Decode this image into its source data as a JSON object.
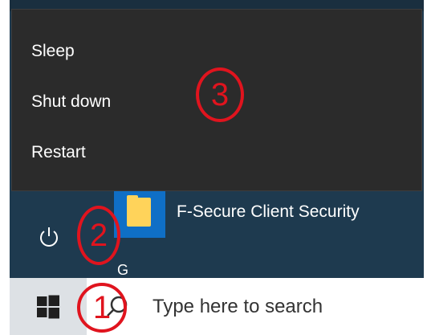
{
  "power_menu": {
    "items": [
      {
        "label": "Sleep"
      },
      {
        "label": "Shut down"
      },
      {
        "label": "Restart"
      }
    ]
  },
  "start_menu": {
    "power_icon": "power-icon",
    "app": {
      "label": "F-Secure Client Security",
      "icon": "folder-icon"
    },
    "partial_glyph": "G"
  },
  "taskbar": {
    "start_icon": "windows-logo-icon",
    "search_icon": "search-icon",
    "search_placeholder": "Type here to search"
  },
  "annotations": {
    "marker_1": "1",
    "marker_2": "2",
    "marker_3": "3"
  },
  "colors": {
    "annotation": "#e0141e",
    "flyout_bg": "#2b2b2b",
    "menu_bg": "#1e3a4f",
    "taskbar_bg": "#dde1e5",
    "tile_blue": "#0f6fc6"
  }
}
